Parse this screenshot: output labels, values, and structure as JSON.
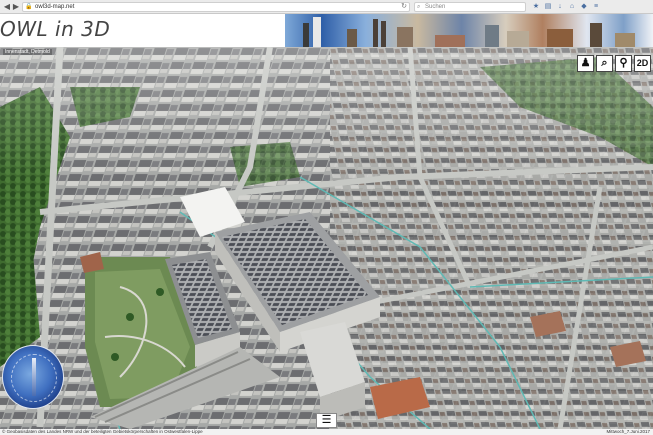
{
  "browser": {
    "url": "owl3d-map.net",
    "search_placeholder": "Suchen",
    "back_glyph": "◀",
    "forward_glyph": "▶",
    "reload_glyph": "↻",
    "lock_glyph": "🔒",
    "search_glyph": "⌕",
    "toolbar_icons": [
      "star-icon",
      "bookmark-icon",
      "download-icon",
      "home-icon",
      "addon-icon",
      "menu-icon"
    ]
  },
  "site": {
    "title": "OWL in 3D"
  },
  "scene": {
    "location_label": "Innenstadt, Detmold"
  },
  "controls": {
    "person_glyph": "♟",
    "search_glyph": "⌕",
    "pin_glyph": "⚲",
    "mode_label": "2D",
    "menu_glyph": "☰"
  },
  "footer": {
    "copyright": "© Geobasisdaten des Landes NRW und der beteiligten Gebietskörperschaften in Ostwestfalen-Lippe",
    "version": "Mittwoch_7.Juni.2017"
  },
  "colors": {
    "roof_gray": "#6f6f72",
    "facade": "#c9c9c6",
    "tree_green": "#2f5a25",
    "street": "#b5b8b3",
    "water_line": "#5fb9b4"
  }
}
